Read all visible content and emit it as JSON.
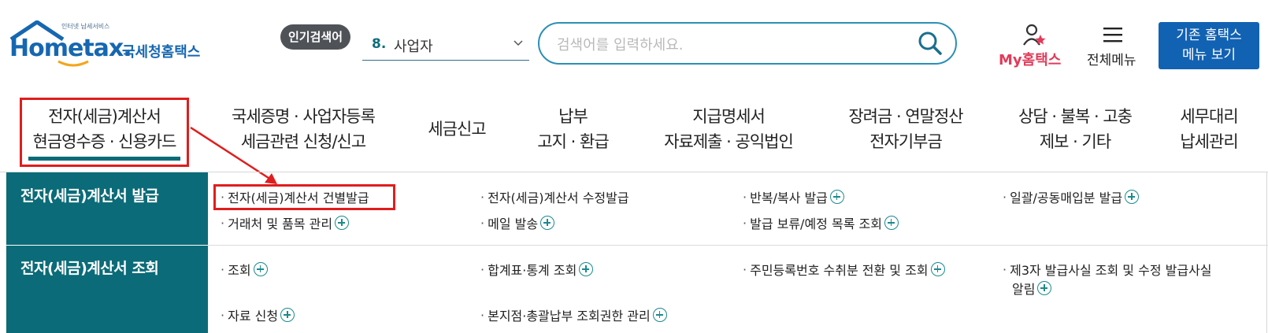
{
  "header": {
    "logo_small": "인터넷 납세서비스",
    "logo_main": "Hometax.",
    "logo_korean": "국세청홈택스",
    "popular_badge": "인기검색어",
    "popular_rank": "8.",
    "popular_keyword": "사업자",
    "search_placeholder": "검색어를 입력하세요.",
    "my_hometax": "My홈택스",
    "all_menu": "전체메뉴",
    "old_menu_line1": "기존 홈택스",
    "old_menu_line2": "메뉴 보기"
  },
  "nav": [
    {
      "line1": "전자(세금)계산서",
      "line2": "현금영수증 · 신용카드"
    },
    {
      "line1": "국세증명 · 사업자등록",
      "line2": "세금관련 신청/신고"
    },
    {
      "line1": "세금신고",
      "line2": ""
    },
    {
      "line1": "납부",
      "line2": "고지 · 환급"
    },
    {
      "line1": "지급명세서",
      "line2": "자료제출 · 공익법인"
    },
    {
      "line1": "장려금 · 연말정산",
      "line2": "전자기부금"
    },
    {
      "line1": "상담 · 불복 · 고충",
      "line2": "제보 · 기타"
    },
    {
      "line1": "세무대리",
      "line2": "납세관리"
    }
  ],
  "submenu": {
    "section1": {
      "title": "전자(세금)계산서 발급",
      "items": [
        "전자(세금)계산서 건별발급",
        "전자(세금)계산서 수정발급",
        "반복/복사 발급",
        "일괄/공동매입분 발급",
        "거래처 및 품목 관리",
        "메일 발송",
        "발급 보류/예정 목록 조회"
      ]
    },
    "section2": {
      "title": "전자(세금)계산서 조회",
      "items": [
        "조회",
        "합계표·통계 조회",
        "주민등록번호 수취분 전환 및 조회",
        "제3자 발급사실 조회 및 수정 발급사실",
        "알림",
        "자료 신청",
        "본지점·총괄납부 조회권한 관리"
      ]
    }
  },
  "colors": {
    "brand_blue": "#1667b1",
    "teal": "#0b6b78",
    "highlight_red": "#e01d1d",
    "my_pink": "#e13b5a"
  }
}
